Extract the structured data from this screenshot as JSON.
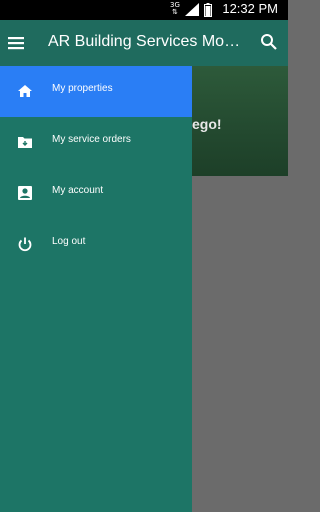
{
  "status_bar": {
    "time": "12:32 PM",
    "network": "3G"
  },
  "app_bar": {
    "title": "AR Building Services Mobile",
    "menu_icon": "menu-icon",
    "search_icon": "search-icon"
  },
  "background": {
    "partial_text": "ego!"
  },
  "drawer": {
    "items": [
      {
        "label": "My properties",
        "icon": "home-icon",
        "active": true
      },
      {
        "label": "My service orders",
        "icon": "folder-icon",
        "active": false
      },
      {
        "label": "My account",
        "icon": "account-box-icon",
        "active": false
      },
      {
        "label": "Log out",
        "icon": "power-icon",
        "active": false
      }
    ]
  },
  "colors": {
    "toolbar": "#1f6b5e",
    "drawer": "#1d7566",
    "active": "#2a7ef5"
  }
}
